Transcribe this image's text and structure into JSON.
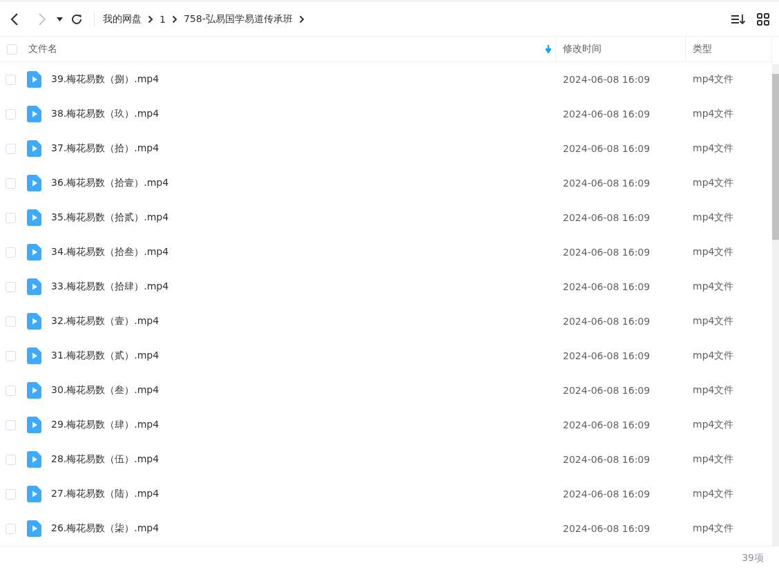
{
  "toolbar": {
    "back": {
      "disabled": false
    },
    "forward": {
      "disabled": true
    },
    "breadcrumb": [
      "我的网盘",
      "1",
      "758-弘易国学易道传承班"
    ]
  },
  "table": {
    "select_all": {
      "checked": false
    },
    "columns": [
      {
        "label": "文件名",
        "sorted": true
      },
      {
        "label": "修改时间",
        "sorted": false
      },
      {
        "label": "类型",
        "sorted": false
      }
    ],
    "rows": [
      {
        "name": "39.梅花易数（捌）.mp4",
        "modified": "2024-06-08 16:09",
        "type": "mp4文件",
        "checked": false
      },
      {
        "name": "38.梅花易数（玖）.mp4",
        "modified": "2024-06-08 16:09",
        "type": "mp4文件",
        "checked": false
      },
      {
        "name": "37.梅花易数（拾）.mp4",
        "modified": "2024-06-08 16:09",
        "type": "mp4文件",
        "checked": false
      },
      {
        "name": "36.梅花易数（拾壹）.mp4",
        "modified": "2024-06-08 16:09",
        "type": "mp4文件",
        "checked": false
      },
      {
        "name": "35.梅花易数（拾贰）.mp4",
        "modified": "2024-06-08 16:09",
        "type": "mp4文件",
        "checked": false
      },
      {
        "name": "34.梅花易数（拾叁）.mp4",
        "modified": "2024-06-08 16:09",
        "type": "mp4文件",
        "checked": false
      },
      {
        "name": "33.梅花易数（拾肆）.mp4",
        "modified": "2024-06-08 16:09",
        "type": "mp4文件",
        "checked": false
      },
      {
        "name": "32.梅花易数（壹）.mp4",
        "modified": "2024-06-08 16:09",
        "type": "mp4文件",
        "checked": false
      },
      {
        "name": "31.梅花易数（贰）.mp4",
        "modified": "2024-06-08 16:09",
        "type": "mp4文件",
        "checked": false
      },
      {
        "name": "30.梅花易数（叁）.mp4",
        "modified": "2024-06-08 16:09",
        "type": "mp4文件",
        "checked": false
      },
      {
        "name": "29.梅花易数（肆）.mp4",
        "modified": "2024-06-08 16:09",
        "type": "mp4文件",
        "checked": false
      },
      {
        "name": "28.梅花易数（伍）.mp4",
        "modified": "2024-06-08 16:09",
        "type": "mp4文件",
        "checked": false
      },
      {
        "name": "27.梅花易数（陆）.mp4",
        "modified": "2024-06-08 16:09",
        "type": "mp4文件",
        "checked": false
      },
      {
        "name": "26.梅花易数（柒）.mp4",
        "modified": "2024-06-08 16:09",
        "type": "mp4文件",
        "checked": false
      }
    ]
  },
  "status_bar": {
    "count": "39项"
  }
}
